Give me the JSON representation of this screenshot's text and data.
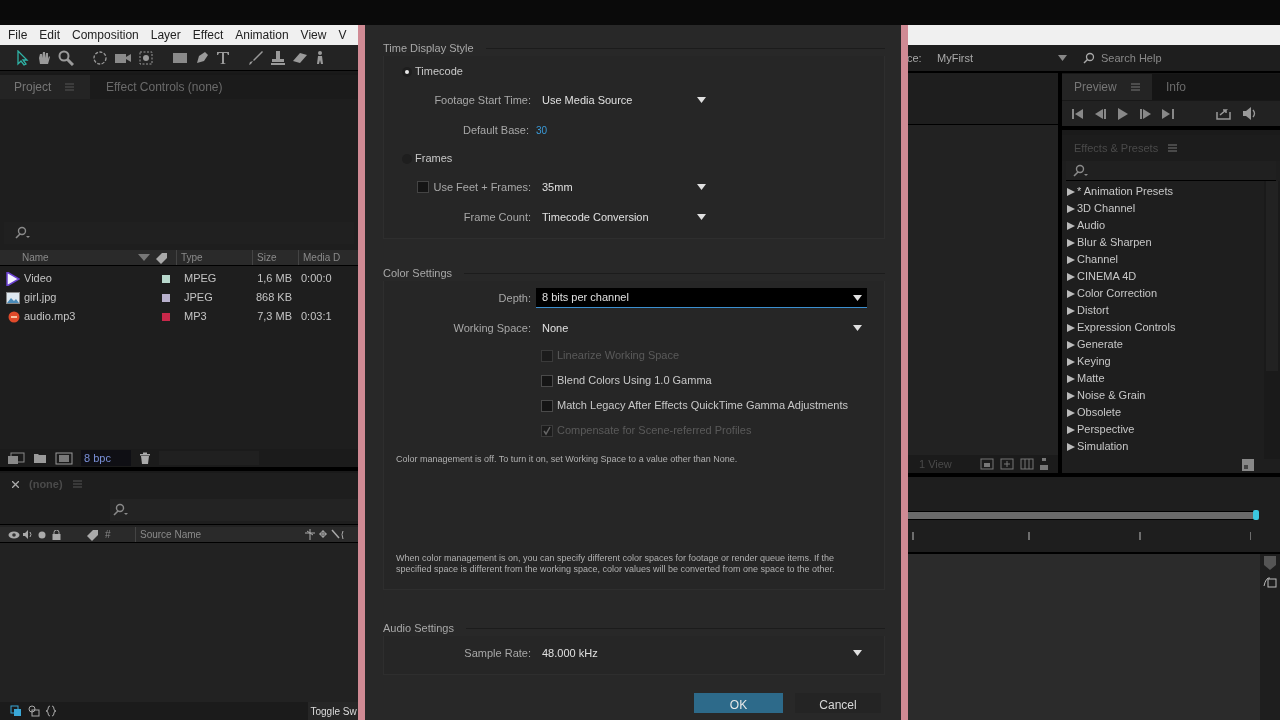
{
  "menu_bar": [
    "File",
    "Edit",
    "Composition",
    "Layer",
    "Effect",
    "Animation",
    "View",
    "V"
  ],
  "project_panel": {
    "tabs": [
      {
        "label": "Project",
        "selected": true
      },
      {
        "label": "Effect Controls (none)",
        "selected": false
      }
    ],
    "columns": [
      "Name",
      "Type",
      "Size",
      "Media D"
    ],
    "rows": [
      {
        "name": "Video",
        "kind": "video",
        "color": "#b8d8cc",
        "type": "MPEG",
        "size": "1,6 MB",
        "duration": "0:00:0"
      },
      {
        "name": "girl.jpg",
        "kind": "image",
        "color": "#b8b0cc",
        "type": "JPEG",
        "size": "868 KB"
      },
      {
        "name": "audio.mp3",
        "kind": "audio",
        "color": "#c8284a",
        "type": "MP3",
        "size": "7,3 MB",
        "duration": "0:03:1"
      }
    ],
    "bit_depth": "8 bpc"
  },
  "timeline_panel": {
    "tab": "(none)",
    "columns": [
      "#",
      "Source Name"
    ],
    "toggle_label": "Toggle Sw"
  },
  "workspace": {
    "label": "ce:",
    "value": "MyFirst"
  },
  "search_help": {
    "placeholder": "Search Help"
  },
  "preview_panel": {
    "tabs": [
      {
        "label": "Preview",
        "selected": true
      },
      {
        "label": "Info",
        "selected": false
      }
    ]
  },
  "effects_presets": {
    "title": "Effects & Presets",
    "items": [
      {
        "label": "* Animation Presets",
        "expanded": false
      },
      {
        "label": "3D Channel",
        "expanded": false
      },
      {
        "label": "Audio",
        "expanded": false
      },
      {
        "label": "Blur & Sharpen",
        "expanded": false
      },
      {
        "label": "Channel",
        "expanded": false
      },
      {
        "label": "CINEMA 4D",
        "expanded": false
      },
      {
        "label": "Color Correction",
        "expanded": false
      },
      {
        "label": "Distort",
        "expanded": false
      },
      {
        "label": "Expression Controls",
        "expanded": false
      },
      {
        "label": "Generate",
        "expanded": false
      },
      {
        "label": "Keying",
        "expanded": false
      },
      {
        "label": "Matte",
        "expanded": false
      },
      {
        "label": "Noise & Grain",
        "expanded": false
      },
      {
        "label": "Obsolete",
        "expanded": false
      },
      {
        "label": "Perspective",
        "expanded": false
      },
      {
        "label": "Simulation",
        "expanded": false
      }
    ]
  },
  "viewer": {
    "view_menu": "1 View"
  },
  "dialog": {
    "time_display_style": {
      "title": "Time Display Style",
      "rows": [
        {
          "kind": "radio",
          "label": "Timecode",
          "selected": true
        },
        {
          "kind": "dropdown",
          "label": "Footage Start Time:",
          "value": "Use Media Source"
        },
        {
          "kind": "number",
          "label": "Default Base:",
          "value": "30"
        },
        {
          "kind": "radio",
          "label": "Frames",
          "selected": false
        },
        {
          "kind": "check_dropdown",
          "label": "Use Feet + Frames:",
          "checked": false,
          "value": "35mm"
        },
        {
          "kind": "dropdown",
          "label": "Frame Count:",
          "value": "Timecode Conversion"
        }
      ]
    },
    "color_settings": {
      "title": "Color Settings",
      "rows": [
        {
          "kind": "dropdown",
          "label": "Depth:",
          "value": "8 bits per channel",
          "focused": true
        },
        {
          "kind": "dropdown",
          "label": "Working Space:",
          "value": "None",
          "focused": false
        },
        {
          "kind": "checkbox",
          "label": "Linearize Working Space",
          "checked": false,
          "disabled": true
        },
        {
          "kind": "checkbox",
          "label": "Blend Colors Using 1.0 Gamma",
          "checked": false,
          "disabled": false
        },
        {
          "kind": "checkbox",
          "label": "Match Legacy After Effects QuickTime Gamma Adjustments",
          "checked": false,
          "disabled": false
        },
        {
          "kind": "checkbox",
          "label": "Compensate for Scene-referred Profiles",
          "checked": true,
          "disabled": true
        }
      ],
      "note": "Color management is off. To turn it on, set Working Space to a value other than None.",
      "info": "When color management is on, you can specify different color spaces for footage or render queue items. If the specified space is different from the working space, color values will be converted from one space to the other."
    },
    "audio_settings": {
      "title": "Audio Settings",
      "rows": [
        {
          "kind": "dropdown",
          "label": "Sample Rate:",
          "value": "48.000 kHz"
        }
      ]
    },
    "buttons": [
      {
        "label": "OK",
        "kind": "primary"
      },
      {
        "label": "Cancel",
        "kind": "secondary"
      }
    ]
  }
}
